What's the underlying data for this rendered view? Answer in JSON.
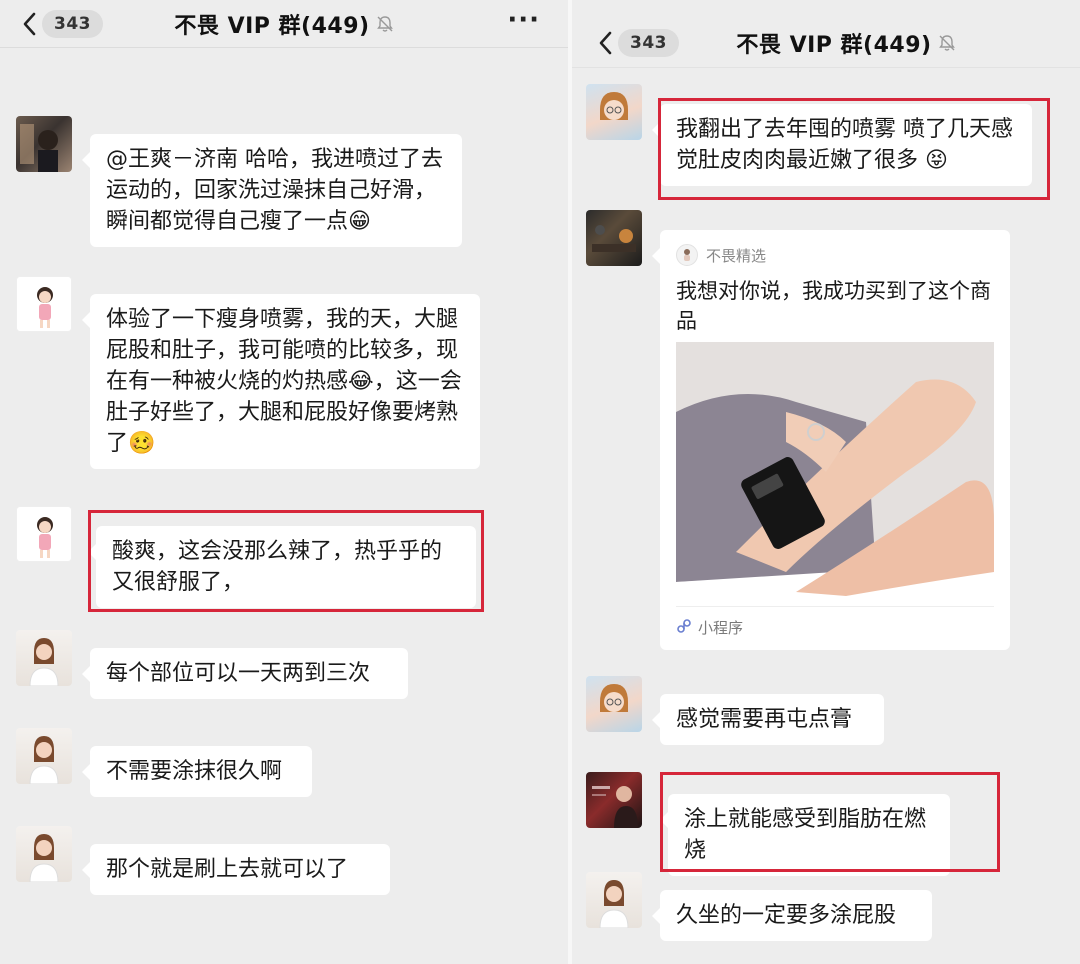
{
  "left": {
    "header": {
      "count": "343",
      "title": "不畏 VIP 群(449)",
      "more": "···"
    },
    "messages": [
      {
        "text": "@王爽－济南 哈哈，我进喷过了去运动的，回家洗过澡抹自己好滑，瞬间都觉得自己瘦了一点😁"
      },
      {
        "text": "体验了一下瘦身喷雾，我的天，大腿屁股和肚子，我可能喷的比较多，现在有一种被火烧的灼热感😂，这一会肚子好些了，大腿和屁股好像要烤熟了🥴"
      },
      {
        "text": "酸爽，这会没那么辣了，热乎乎的又很舒服了，"
      },
      {
        "text": "每个部位可以一天两到三次"
      },
      {
        "text": "不需要涂抹很久啊"
      },
      {
        "text": "那个就是刷上去就可以了"
      }
    ]
  },
  "right": {
    "header": {
      "count": "343",
      "title": "不畏 VIP 群(449)"
    },
    "messages": [
      {
        "text": "我翻出了去年囤的喷雾  喷了几天感觉肚皮肉肉最近嫩了很多 😝"
      },
      {
        "card": {
          "source": "不畏精选",
          "title": "我想对你说，我成功买到了这个商品",
          "footer": "小程序"
        }
      },
      {
        "text": "感觉需要再屯点膏"
      },
      {
        "text": "涂上就能感受到脂肪在燃烧"
      },
      {
        "text": "久坐的一定要多涂屁股"
      }
    ]
  },
  "colors": {
    "background": "#ededed",
    "bubble": "#ffffff",
    "highlight": "#d6263a"
  },
  "icons": [
    "chevron-left-icon",
    "mute-bell-icon",
    "more-dots-icon",
    "mini-program-icon"
  ]
}
